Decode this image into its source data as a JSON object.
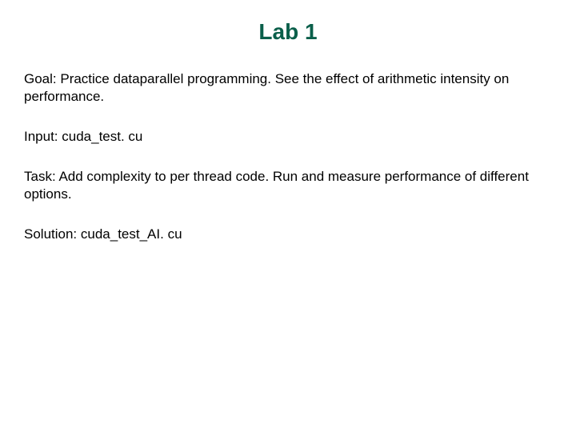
{
  "title": "Lab 1",
  "paragraphs": {
    "goal": "Goal:  Practice dataparallel programming.  See the effect of arithmetic intensity on performance.",
    "input": "Input:  cuda_test. cu",
    "task": "Task:  Add complexity to per thread code.  Run and measure performance of different options.",
    "solution": "Solution:  cuda_test_AI. cu"
  }
}
